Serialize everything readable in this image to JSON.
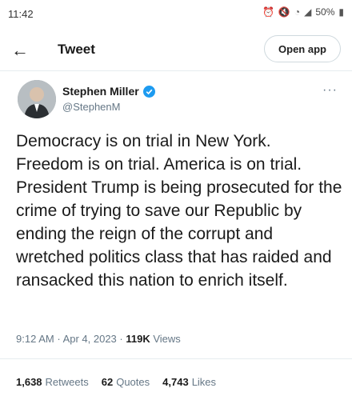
{
  "status": {
    "time": "11:42",
    "battery": "50%",
    "icons": [
      "alarm-icon",
      "mute-icon",
      "wifi-icon",
      "signal-icon",
      "battery-icon"
    ]
  },
  "header": {
    "title": "Tweet",
    "open_app_label": "Open app",
    "back_icon": "back-arrow-icon"
  },
  "tweet": {
    "author_name": "Stephen Miller",
    "author_handle": "@StephenM",
    "verified_color": "#1d9bf0",
    "text": "Democracy is on trial in New York. Freedom is on trial. America is on trial. President Trump is being prosecuted for the crime of trying to save our Republic by ending the reign of the corrupt and wretched politics class that has raided and ransacked this nation to enrich itself.",
    "time": "9:12 AM",
    "date": "Apr 4, 2023",
    "views_count": "119K",
    "views_label": "Views",
    "stats": [
      {
        "count": "1,638",
        "label": "Retweets"
      },
      {
        "count": "62",
        "label": "Quotes"
      },
      {
        "count": "4,743",
        "label": "Likes"
      }
    ]
  }
}
